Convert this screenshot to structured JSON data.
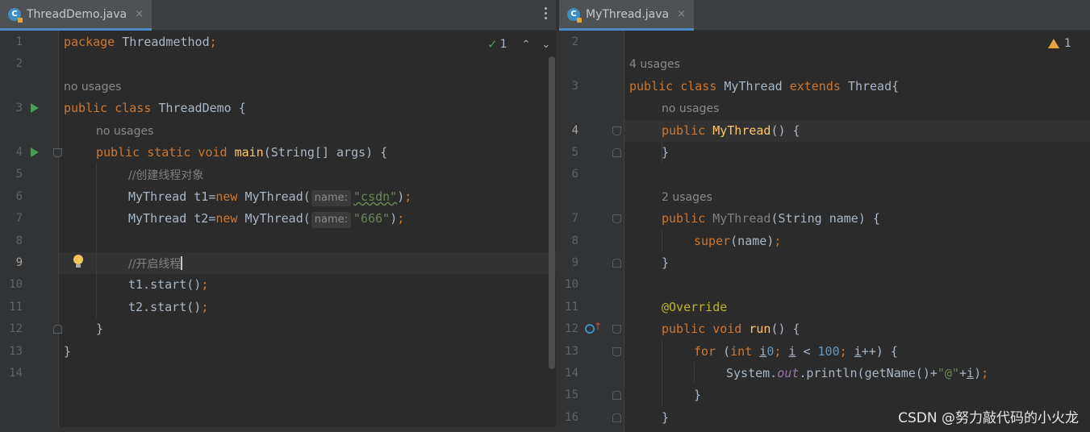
{
  "left_editor": {
    "tab": {
      "title": "ThreadDemo.java",
      "icon_letter": "C",
      "close": "×"
    },
    "status": {
      "check_count": "1"
    },
    "lines": [
      {
        "num": "1",
        "parts": [
          [
            "kw",
            "package "
          ],
          [
            "",
            "Threadmethod"
          ],
          [
            "kw",
            ";"
          ]
        ]
      },
      {
        "num": "2",
        "parts": []
      },
      {
        "hint": "no usages"
      },
      {
        "num": "3",
        "parts": [
          [
            "kw",
            "public class "
          ],
          [
            "",
            "ThreadDemo {"
          ]
        ]
      },
      {
        "hint": "no usages",
        "indent": 1
      },
      {
        "num": "4",
        "parts": [
          [
            "kw",
            "public static void "
          ],
          [
            "fn",
            "main"
          ],
          [
            "",
            "(String[] args) {"
          ]
        ],
        "indent": 1
      },
      {
        "num": "5",
        "parts": [
          [
            "cmt",
            "//创建线程对象"
          ]
        ],
        "indent": 2
      },
      {
        "num": "6",
        "parts": [
          [
            "",
            "MyThread t1="
          ],
          [
            "kw",
            "new "
          ],
          [
            "",
            "MyThread("
          ],
          [
            "inlay",
            "name:"
          ],
          [
            "str",
            "\"csdn\""
          ],
          [
            "",
            ")"
          ],
          [
            "kw",
            ";"
          ]
        ],
        "indent": 2
      },
      {
        "num": "7",
        "parts": [
          [
            "",
            "MyThread t2="
          ],
          [
            "kw",
            "new "
          ],
          [
            "",
            "MyThread("
          ],
          [
            "inlay",
            "name:"
          ],
          [
            "str",
            "\"666\""
          ],
          [
            "",
            ")"
          ],
          [
            "kw",
            ";"
          ]
        ],
        "indent": 2
      },
      {
        "num": "8",
        "parts": []
      },
      {
        "num": "9",
        "parts": [
          [
            "cmt",
            "//开启线程"
          ]
        ],
        "indent": 2,
        "current": true
      },
      {
        "num": "10",
        "parts": [
          [
            "",
            "t1.start()"
          ],
          [
            "kw",
            ";"
          ]
        ],
        "indent": 2
      },
      {
        "num": "11",
        "parts": [
          [
            "",
            "t2.start()"
          ],
          [
            "kw",
            ";"
          ]
        ],
        "indent": 2
      },
      {
        "num": "12",
        "parts": [
          [
            "",
            "}"
          ]
        ],
        "indent": 1
      },
      {
        "num": "13",
        "parts": [
          [
            "",
            "}"
          ]
        ]
      },
      {
        "num": "14",
        "parts": []
      }
    ]
  },
  "right_editor": {
    "tab": {
      "title": "MyThread.java",
      "icon_letter": "C",
      "close": "×"
    },
    "status": {
      "warning_count": "1"
    },
    "lines": [
      {
        "num": "2",
        "parts": []
      },
      {
        "hint": "4 usages"
      },
      {
        "num": "3",
        "parts": [
          [
            "kw",
            "public class "
          ],
          [
            "",
            "MyThread "
          ],
          [
            "kw",
            "extends "
          ],
          [
            "",
            "Thread{"
          ]
        ]
      },
      {
        "hint": "no usages",
        "indent": 1
      },
      {
        "num": "4",
        "parts": [
          [
            "kw",
            "public "
          ],
          [
            "fn",
            "MyThread"
          ],
          [
            "",
            "() {"
          ]
        ],
        "indent": 1,
        "current": true
      },
      {
        "num": "5",
        "parts": [
          [
            "",
            "}"
          ]
        ],
        "indent": 1
      },
      {
        "num": "6",
        "parts": []
      },
      {
        "hint": "2 usages",
        "indent": 1
      },
      {
        "num": "7",
        "parts": [
          [
            "kw",
            "public "
          ],
          [
            "unused",
            "MyThread"
          ],
          [
            "",
            "(String name) {"
          ]
        ],
        "indent": 1
      },
      {
        "num": "8",
        "parts": [
          [
            "kw",
            "super"
          ],
          [
            "",
            "(name)"
          ],
          [
            "kw",
            ";"
          ]
        ],
        "indent": 2
      },
      {
        "num": "9",
        "parts": [
          [
            "",
            "}"
          ]
        ],
        "indent": 1
      },
      {
        "num": "10",
        "parts": []
      },
      {
        "num": "11",
        "parts": [
          [
            "ann",
            "@Override"
          ]
        ],
        "indent": 1
      },
      {
        "num": "12",
        "parts": [
          [
            "kw",
            "public void "
          ],
          [
            "fn",
            "run"
          ],
          [
            "",
            "() {"
          ]
        ],
        "indent": 1
      },
      {
        "num": "13",
        "parts": [
          [
            "kw",
            "for "
          ],
          [
            "",
            "("
          ],
          [
            "kw",
            "int "
          ],
          [
            "ul",
            "i"
          ],
          [
            "",
            "",
            " = "
          ],
          [
            "num",
            "0"
          ],
          [
            "kw",
            "; "
          ],
          [
            "ul",
            "i"
          ],
          [
            "",
            " < "
          ],
          [
            "num",
            "100"
          ],
          [
            "kw",
            "; "
          ],
          [
            "ul",
            "i"
          ],
          [
            "",
            "++) {"
          ]
        ],
        "indent": 2
      },
      {
        "num": "14",
        "parts": [
          [
            "",
            "System."
          ],
          [
            "st",
            "out"
          ],
          [
            "",
            ".println(getName()+"
          ],
          [
            "str",
            "\"@\""
          ],
          [
            "",
            "+"
          ],
          [
            "ul",
            "i"
          ],
          [
            "",
            ")"
          ],
          [
            "kw",
            ";"
          ]
        ],
        "indent": 3
      },
      {
        "num": "15",
        "parts": [
          [
            "",
            "}"
          ]
        ],
        "indent": 2
      },
      {
        "num": "16",
        "parts": [
          [
            "",
            "}"
          ]
        ],
        "indent": 1
      }
    ]
  },
  "watermark": "CSDN @努力敲代码的小火龙",
  "colors": {
    "background": "#2b2b2b",
    "keyword": "#cc7832",
    "function": "#ffc66d",
    "string": "#6a8759",
    "number": "#6897bb",
    "annotation": "#bbb529"
  }
}
